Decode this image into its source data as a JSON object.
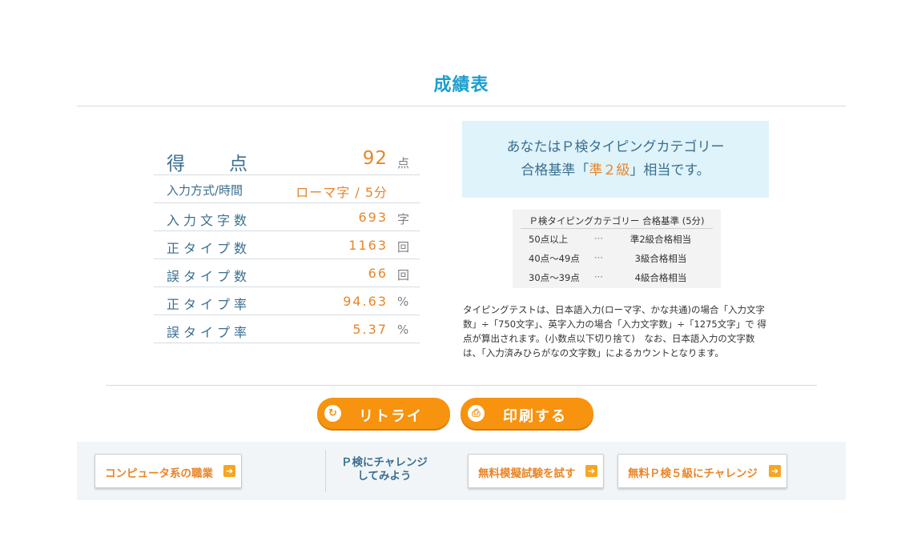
{
  "page": {
    "title": "成績表"
  },
  "score": {
    "main_label_chars": [
      "得",
      "点"
    ],
    "main_value": "92",
    "main_unit": "点",
    "method_label": "入力方式/時間",
    "method_value": "ローマ字 / 5分",
    "rows": [
      {
        "label": "入力文字数",
        "value": "693",
        "unit": "字"
      },
      {
        "label": "正タイプ数",
        "value": "1163",
        "unit": "回"
      },
      {
        "label": "誤タイプ数",
        "value": "66",
        "unit": "回"
      },
      {
        "label": "正タイプ率",
        "value": "94.63",
        "unit": "%"
      },
      {
        "label": "誤タイプ率",
        "value": "5.37",
        "unit": "%"
      }
    ]
  },
  "result": {
    "line1": "あなたはＰ検タイピングカテゴリー",
    "line2_pre": "合格基準「",
    "line2_grade": "準２級",
    "line2_post": "」相当です。"
  },
  "criteria": {
    "header": "Ｐ検タイピングカテゴリー 合格基準 (5分)",
    "rows": [
      {
        "range": "50点以上",
        "sep": "···",
        "grade": "準2級合格相当"
      },
      {
        "range": "40点～49点",
        "sep": "···",
        "grade": "3級合格相当"
      },
      {
        "range": "30点～39点",
        "sep": "···",
        "grade": "4級合格相当"
      }
    ]
  },
  "note": {
    "lines": [
      "タイピングテストは、日本語入力(ローマ字、かな共通)の場合「入力文字",
      "数」÷「750文字」、英字入力の場合「入力文字数」÷「1275文字」で 得",
      "点が算出されます。(小数点以下切り捨て)　なお、日本語入力の文字数",
      "は、「入力済みひらがなの文字数」によるカウントとなります。"
    ]
  },
  "buttons": {
    "retry": "リトライ",
    "print": "印刷する"
  },
  "footer": {
    "jobs": "コンピュータ系の職業",
    "challenge_line1": "Ｐ検にチャレンジ",
    "challenge_line2": "してみよう",
    "mock": "無料模擬試験を試す",
    "grade5": "無料Ｐ検５級にチャレンジ"
  },
  "colors": {
    "title": "#1c9fd0",
    "accent": "#e8862a",
    "button": "#f7930e",
    "result_bg": "#dff3fb"
  },
  "icons": {
    "retry": "retry-icon",
    "print": "printer-icon",
    "arrow": "arrow-right-icon"
  }
}
